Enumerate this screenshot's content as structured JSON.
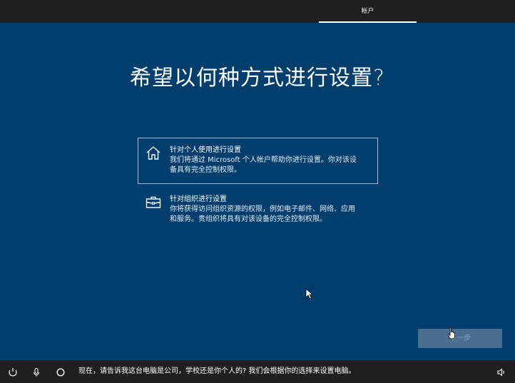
{
  "topbar": {
    "tab_label": "帐户"
  },
  "main": {
    "title": "希望以何种方式进行设置?"
  },
  "options": [
    {
      "heading": "针对个人使用进行设置",
      "desc_line1": "我们将通过 Microsoft 个人帐户帮助你进行设置。你对该设",
      "desc_line2": "备具有完全控制权限。",
      "icon": "home-icon",
      "selected": true
    },
    {
      "heading": "针对组织进行设置",
      "desc_line1": "你将获得访问组织资源的权限，例如电子邮件、网络、应用",
      "desc_line2": "和服务。贵组织将具有对该设备的完全控制权限。",
      "icon": "briefcase-icon",
      "selected": false
    }
  ],
  "footer": {
    "next_label": "下一步"
  },
  "bottombar": {
    "status_text": "现在，请告诉我这台电脑是公司，学校还是你个人的?  我们会根据你的选择来设置电脑。",
    "icons": [
      "ease-of-access-icon",
      "microphone-icon",
      "cortana-icon",
      "volume-icon"
    ]
  },
  "colors": {
    "background": "#003e6e",
    "bar": "#1f1f1f",
    "button_disabled": "#4a6e8f"
  }
}
